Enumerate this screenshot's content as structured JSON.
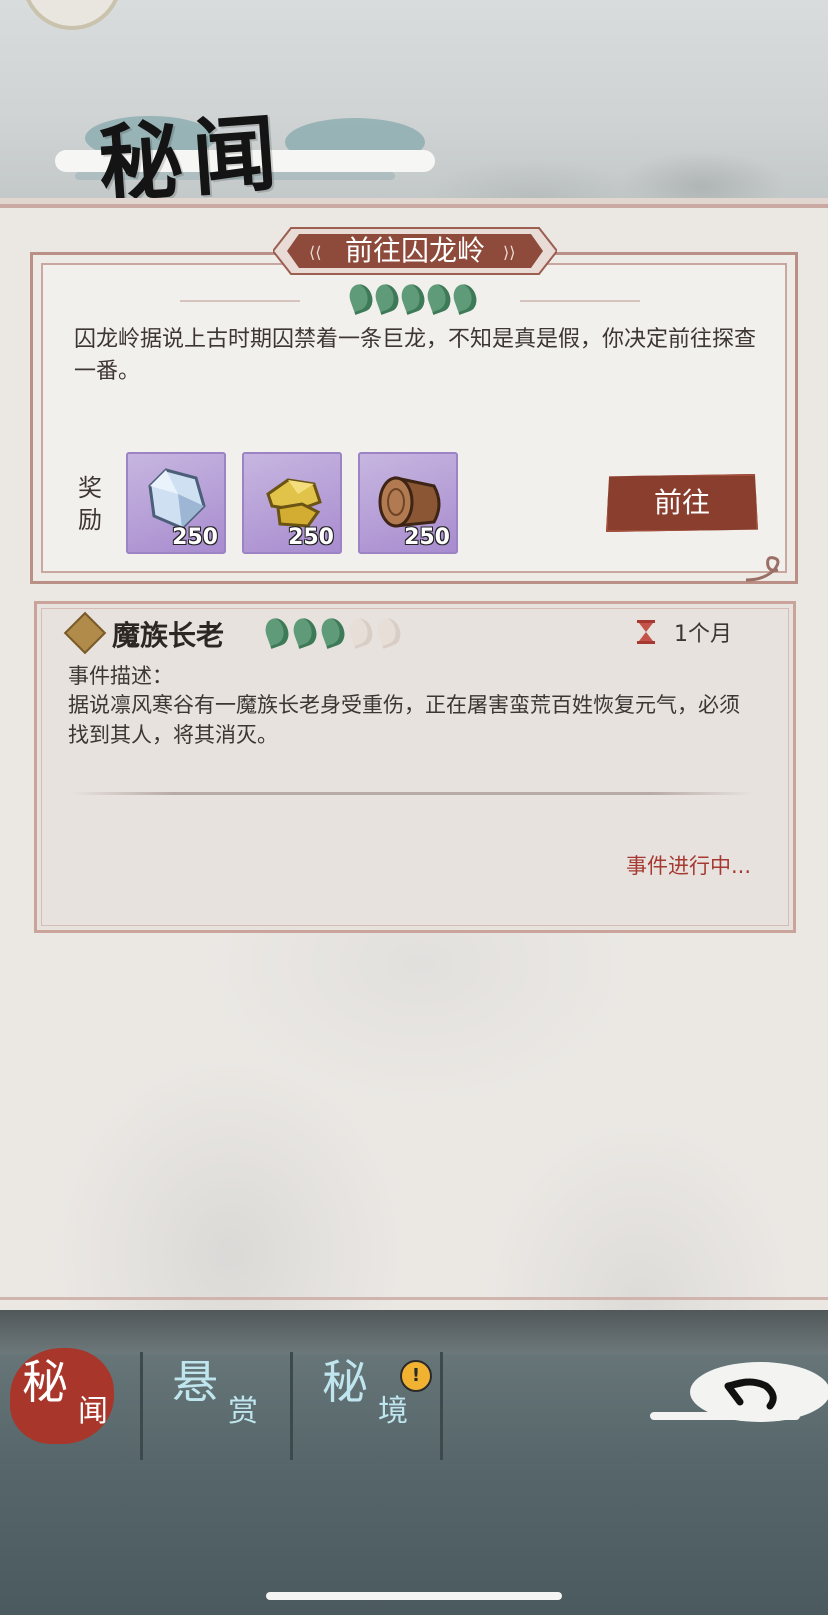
{
  "header": {
    "title": "秘闻"
  },
  "active_event": {
    "banner": "前往囚龙岭",
    "difficulty_total": 5,
    "difficulty_filled": 5,
    "description": "囚龙岭据说上古时期囚禁着一条巨龙，不知是真是假，你决定前往探查一番。",
    "reward_label": "奖励",
    "rewards": [
      {
        "icon": "crystal-icon",
        "count": "250"
      },
      {
        "icon": "gold-ore-icon",
        "count": "250"
      },
      {
        "icon": "wood-log-icon",
        "count": "250"
      }
    ],
    "go_button": "前往"
  },
  "ongoing_event": {
    "title": "魔族长老",
    "difficulty_total": 5,
    "difficulty_filled": 3,
    "duration": "1个月",
    "description_label": "事件描述：",
    "description": "据说凛风寒谷有一魔族长老身受重伤，正在屠害蛮荒百姓恢复元气，必须找到其人，将其消灭。",
    "status": "事件进行中..."
  },
  "tabs": [
    {
      "big": "秘",
      "small": "闻",
      "active": true
    },
    {
      "big": "悬",
      "small": "赏",
      "active": false
    },
    {
      "big": "秘",
      "small": "境",
      "active": false,
      "alert": "!"
    }
  ],
  "colors": {
    "accent": "#8a3e2e",
    "difficulty_on": "#5f9b78",
    "status": "#a63a32",
    "reward_bg": "#b9a3da"
  }
}
